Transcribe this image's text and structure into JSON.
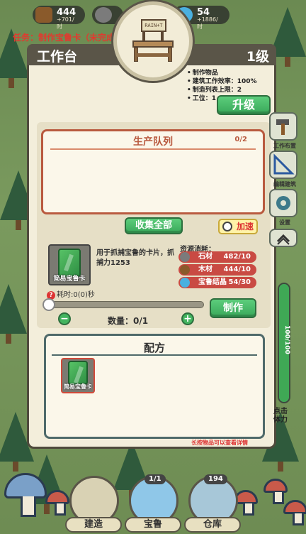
{
  "hud": {
    "stone": {
      "value": "444",
      "rate": "+701/时"
    },
    "coin": {
      "value": "54",
      "rate": "+1886/时"
    }
  },
  "quest_text": "任务：制作宝鲁卡（未完成",
  "building": {
    "name": "工作台",
    "level": "1级",
    "sign_text": "RAIN+T",
    "stats": [
      "制作物品",
      "建筑工作效率：100%",
      "制造列表上限：2",
      "工位：1"
    ],
    "upgrade_label": "升级"
  },
  "queue": {
    "title": "生产队列",
    "count": "0/2"
  },
  "collect_all_label": "收集全部",
  "speedup_label": "加速",
  "item": {
    "name": "简易宝鲁卡",
    "description": "用于抓捕宝鲁的卡片，抓捕力1253",
    "time_label": "耗时:0(0)秒",
    "quantity_label": "数量：0/1",
    "make_label": "制作"
  },
  "resources": {
    "title": "资源消耗：",
    "items": [
      {
        "name": "石材",
        "amount": "482/10",
        "icon": "stone-icon",
        "color": "#7b7b7b"
      },
      {
        "name": "木材",
        "amount": "444/10",
        "icon": "wood-icon",
        "color": "#8a5a2b"
      },
      {
        "name": "宝鲁结晶",
        "amount": "54/30",
        "icon": "crystal-icon",
        "color": "#4ab0e0"
      }
    ]
  },
  "recipe": {
    "title": "配方",
    "card_label": "简易宝鲁卡",
    "hint": "长按物品可以查看详情"
  },
  "side": {
    "layout_label": "工作布置",
    "edit_label": "编辑建筑",
    "settings_label": "设置"
  },
  "stamina": {
    "label": "100/100",
    "fill_fraction": 1.0,
    "tap_label": "点击\n体力"
  },
  "nav": {
    "build_label": "建造",
    "pal_label": "宝鲁",
    "pal_badge": "1/1",
    "storage_label": "仓库",
    "storage_badge": "194"
  },
  "colors": {
    "accent_green": "#3fa855",
    "danger_red": "#c94a43",
    "panel_bg": "#f3eedb"
  }
}
